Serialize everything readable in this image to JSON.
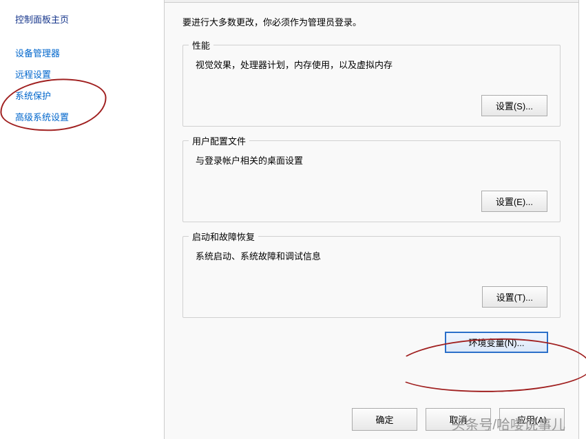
{
  "sidebar": {
    "home": "控制面板主页",
    "items": [
      "设备管理器",
      "远程设置",
      "系统保护",
      "高级系统设置"
    ]
  },
  "dialog": {
    "intro": "要进行大多数更改，你必须作为管理员登录。",
    "sections": {
      "performance": {
        "title": "性能",
        "desc": "视觉效果，处理器计划，内存使用，以及虚拟内存",
        "button": "设置(S)..."
      },
      "userprofile": {
        "title": "用户配置文件",
        "desc": "与登录帐户相关的桌面设置",
        "button": "设置(E)..."
      },
      "startup": {
        "title": "启动和故障恢复",
        "desc": "系统启动、系统故障和调试信息",
        "button": "设置(T)..."
      }
    },
    "envvars": "环境变量(N)...",
    "ok": "确定",
    "cancel": "取消",
    "apply": "应用(A)"
  },
  "watermark": "头条号/哈喽说事儿"
}
